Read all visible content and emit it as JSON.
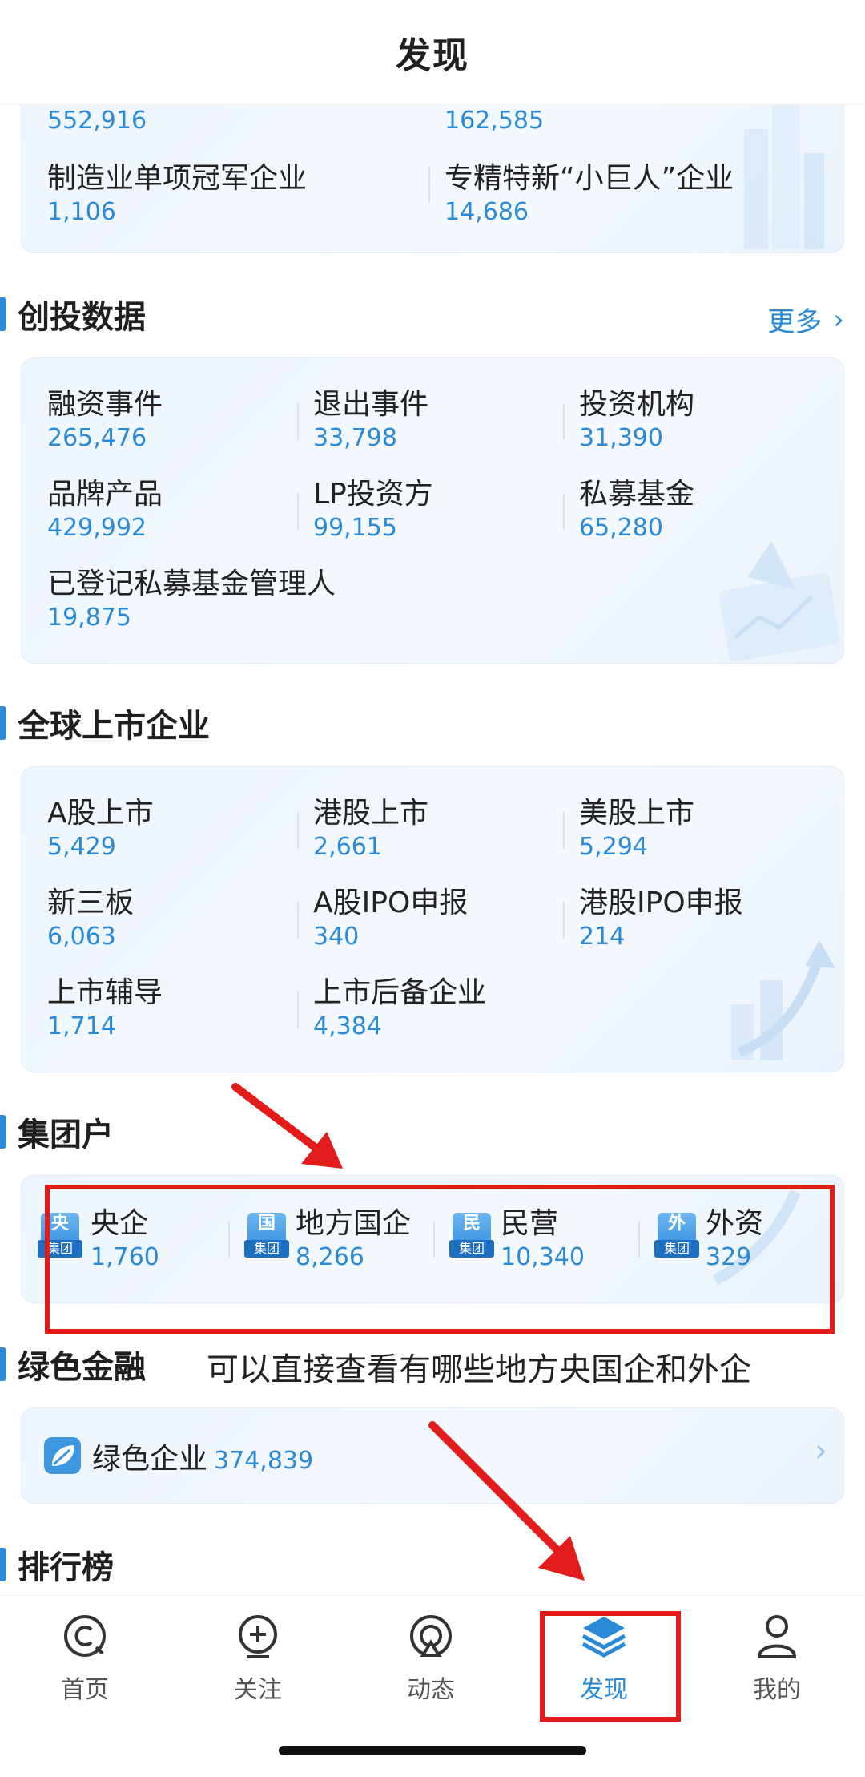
{
  "header": {
    "title": "发现"
  },
  "top_card": {
    "partial_values": [
      "552,916",
      "162,585"
    ],
    "items": [
      {
        "name": "制造业单项冠军企业",
        "value": "1,106"
      },
      {
        "name": "专精特新“小巨人”企业",
        "value": "14,686"
      }
    ]
  },
  "vc": {
    "title": "创投数据",
    "more": "更多",
    "items": [
      {
        "name": "融资事件",
        "value": "265,476"
      },
      {
        "name": "退出事件",
        "value": "33,798"
      },
      {
        "name": "投资机构",
        "value": "31,390"
      },
      {
        "name": "品牌产品",
        "value": "429,992"
      },
      {
        "name": "LP投资方",
        "value": "99,155"
      },
      {
        "name": "私募基金",
        "value": "65,280"
      },
      {
        "name": "已登记私募基金管理人",
        "value": "19,875"
      }
    ]
  },
  "listed": {
    "title": "全球上市企业",
    "items": [
      {
        "name": "A股上市",
        "value": "5,429"
      },
      {
        "name": "港股上市",
        "value": "2,661"
      },
      {
        "name": "美股上市",
        "value": "5,294"
      },
      {
        "name": "新三板",
        "value": "6,063"
      },
      {
        "name": "A股IPO申报",
        "value": "340"
      },
      {
        "name": "港股IPO申报",
        "value": "214"
      },
      {
        "name": "上市辅导",
        "value": "1,714"
      },
      {
        "name": "上市后备企业",
        "value": "4,384"
      }
    ]
  },
  "group": {
    "title": "集团户",
    "items": [
      {
        "icon_text": "央",
        "icon_sub": "集团",
        "name": "央企",
        "value": "1,760"
      },
      {
        "icon_text": "国",
        "icon_sub": "集团",
        "name": "地方国企",
        "value": "8,266"
      },
      {
        "icon_text": "民",
        "icon_sub": "集团",
        "name": "民营",
        "value": "10,340"
      },
      {
        "icon_text": "外",
        "icon_sub": "集团",
        "name": "外资",
        "value": "329"
      }
    ]
  },
  "green": {
    "title": "绿色金融",
    "annotation": "可以直接查看有哪些地方央国企和外企",
    "item": {
      "name": "绿色企业",
      "value": "374,839"
    }
  },
  "ranking": {
    "title": "排行榜"
  },
  "nav": {
    "items": [
      {
        "label": "首页",
        "icon": "home-icon"
      },
      {
        "label": "关注",
        "icon": "follow-plus-icon"
      },
      {
        "label": "动态",
        "icon": "activity-icon"
      },
      {
        "label": "发现",
        "icon": "discover-layers-icon"
      },
      {
        "label": "我的",
        "icon": "profile-icon"
      }
    ],
    "active": "发现"
  },
  "colors": {
    "accent": "#2b8ad6",
    "annotation_red": "#e21b1b"
  }
}
